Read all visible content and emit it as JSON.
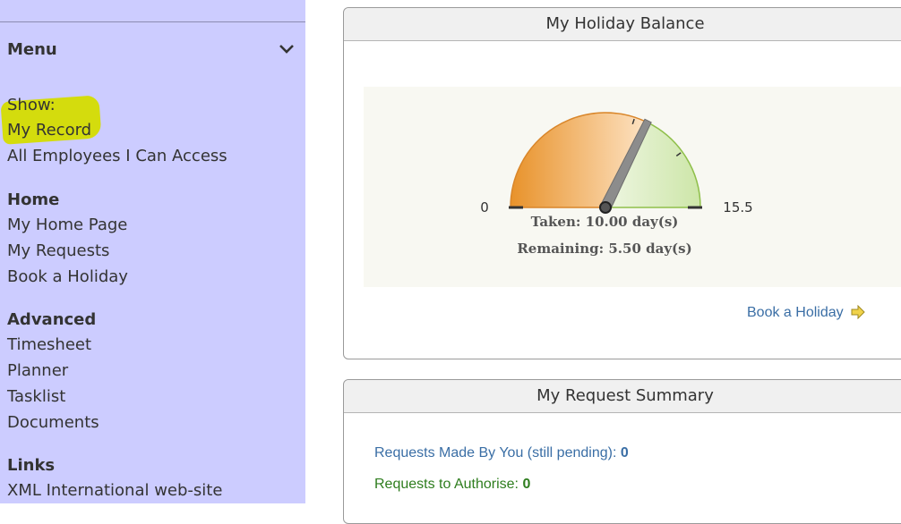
{
  "sidebar": {
    "menu_title": "Menu",
    "show": {
      "heading": "Show:",
      "items": [
        "My Record",
        "All Employees I Can Access"
      ]
    },
    "home": {
      "heading": "Home",
      "items": [
        "My Home Page",
        "My Requests",
        "Book a Holiday"
      ]
    },
    "advanced": {
      "heading": "Advanced",
      "items": [
        "Timesheet",
        "Planner",
        "Tasklist",
        "Documents"
      ]
    },
    "links": {
      "heading": "Links",
      "items": [
        "XML International web-site"
      ]
    }
  },
  "holiday_balance": {
    "title": "My Holiday Balance",
    "gauge": {
      "min_label": "0",
      "max_label": "15.5",
      "min": 0,
      "max": 15.5,
      "taken": 10.0,
      "taken_text": "Taken: 10.00 day(s)",
      "remaining_text": "Remaining: 5.50 day(s)"
    },
    "book_link": "Book a Holiday"
  },
  "request_summary": {
    "title": "My Request Summary",
    "made_label": "Requests Made By You (still pending):",
    "made_count": "0",
    "authorise_label": "Requests to Authorise:",
    "authorise_count": "0"
  },
  "colors": {
    "sidebar_bg": "#ccccff",
    "highlight": "#d4dc00",
    "taken_orange": "#e8922a",
    "remaining_green": "#cde6a8",
    "link_blue": "#3a6ea5",
    "authorise_green": "#2e7d1e"
  }
}
